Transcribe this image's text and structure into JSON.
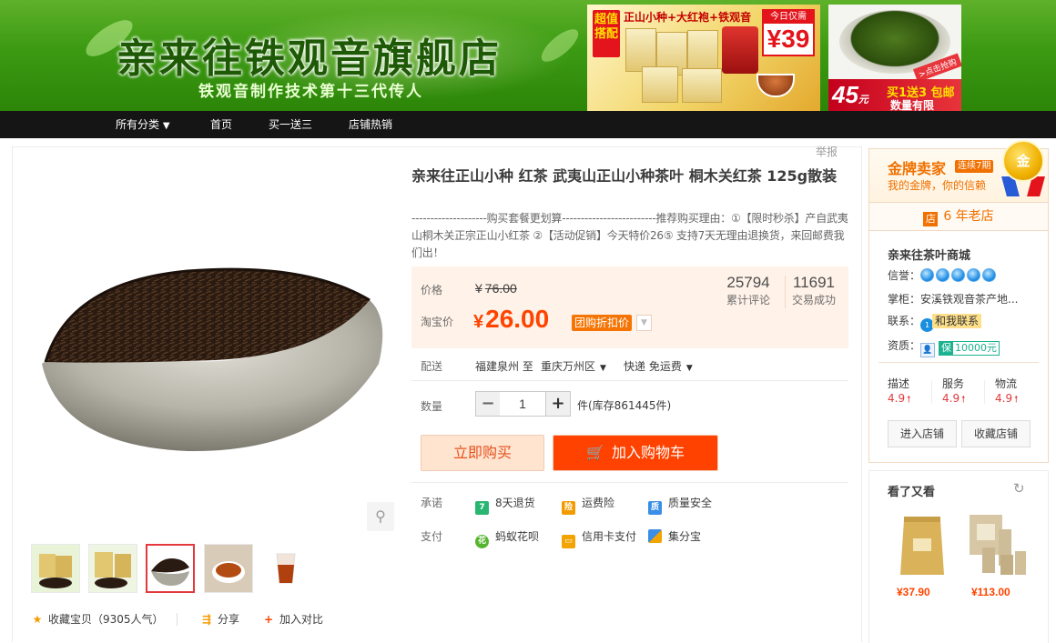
{
  "banner": {
    "store_name": "亲来往铁观音旗舰店",
    "slogan": "铁观音制作技术第十三代传人",
    "promo1": {
      "super_tag": "超值搭配",
      "topline": "正山小种+大红袍+铁观音",
      "today_label": "今日仅需",
      "today_price": "¥39"
    },
    "promo2": {
      "price": "45",
      "price_unit": "元",
      "offer": "买1送3 包邮",
      "limit": "数量有限",
      "corner": ">点击抢购"
    }
  },
  "nav": {
    "items": [
      "所有分类",
      "首页",
      "买一送三",
      "店铺热销"
    ]
  },
  "report_label": "举报",
  "product": {
    "title": "亲来往正山小种 红茶 武夷山正山小种茶叶 桐木关红茶 125g散装",
    "description": "--------------------购买套餐更划算-------------------------推荐购买理由：①【限时秒杀】产自武夷山桐木关正宗正山小红茶 ②【活动促销】今天特价26⑤ 支持7天无理由退换货，来回邮费我们出！"
  },
  "price": {
    "original_label": "价格",
    "original_currency": "¥",
    "original_value": "76.00",
    "promo_label": "淘宝价",
    "promo_currency": "¥",
    "promo_value": "26.00",
    "promo_badge": "团购折扣价",
    "stats": [
      {
        "value": "25794",
        "label": "累计评论"
      },
      {
        "value": "11691",
        "label": "交易成功"
      }
    ]
  },
  "shipping": {
    "label": "配送",
    "from": "福建泉州 至",
    "to": "重庆万州区",
    "method": "快递 免运费"
  },
  "quantity": {
    "label": "数量",
    "minus": "−",
    "value": "1",
    "plus": "+",
    "stock": "件(库存861445件)"
  },
  "buttons": {
    "buy_now": "立即购买",
    "add_cart": "加入购物车"
  },
  "promise": {
    "label": "承诺",
    "items": [
      {
        "text": "8天退货",
        "icon": "seven-day-icon",
        "color": "#29b673"
      },
      {
        "text": "运费险",
        "icon": "freight-insurance-icon",
        "color": "#f29b00"
      },
      {
        "text": "质量安全",
        "icon": "quality-shield-icon",
        "color": "#3a8ee6"
      }
    ]
  },
  "payment": {
    "label": "支付",
    "items": [
      {
        "text": "蚂蚁花呗",
        "icon": "huabei-icon",
        "color": "#55b52e"
      },
      {
        "text": "信用卡支付",
        "icon": "credit-card-icon",
        "color": "#f2a400"
      },
      {
        "text": "集分宝",
        "icon": "jifenbao-icon",
        "color": "#3a8ee6"
      }
    ]
  },
  "actions": {
    "favorite": "收藏宝贝（9305人气）",
    "share": "分享",
    "compare": "加入对比"
  },
  "seller": {
    "gold_title": "金牌卖家",
    "gold_badge": "连续7期",
    "gold_sub": "我的金牌，你的信赖",
    "medal": "金",
    "years_icon": "店",
    "years": "6 年老店",
    "shop_name": "亲来往茶叶商城",
    "credit_label": "信誉：",
    "keeper_label": "掌柜：",
    "keeper": "安溪铁观音茶产地...",
    "contact_label": "联系：",
    "contact_text": "和我联系",
    "qual_label": "资质：",
    "deposit": "10000元",
    "dsr": [
      {
        "label": "描述",
        "value": "4.9"
      },
      {
        "label": "服务",
        "value": "4.9"
      },
      {
        "label": "物流",
        "value": "4.9"
      }
    ],
    "enter_shop": "进入店铺",
    "fav_shop": "收藏店铺"
  },
  "also_viewed": {
    "title": "看了又看",
    "items": [
      {
        "price": "¥37.90"
      },
      {
        "price": "¥113.00"
      }
    ]
  },
  "colors": {
    "accent": "#ff4400",
    "nav_bg": "#151515",
    "banner_green": "#3b9a12",
    "price_bg": "#fff2e8",
    "gold": "#f07000"
  }
}
